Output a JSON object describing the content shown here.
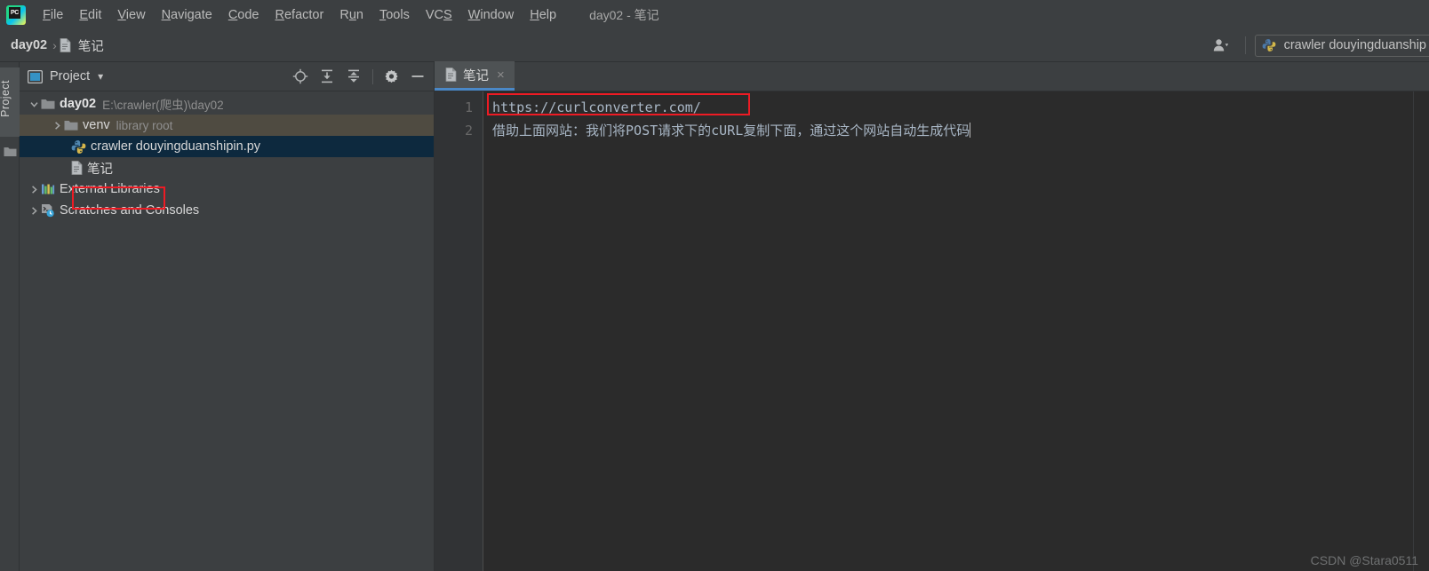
{
  "window": {
    "title": "day02 - 笔记",
    "app_icon": "pycharm-logo-icon",
    "logo_text": "PC"
  },
  "menubar": {
    "items": [
      {
        "label": "File",
        "mnemonic": "F"
      },
      {
        "label": "Edit",
        "mnemonic": "E"
      },
      {
        "label": "View",
        "mnemonic": "V"
      },
      {
        "label": "Navigate",
        "mnemonic": "N"
      },
      {
        "label": "Code",
        "mnemonic": "C"
      },
      {
        "label": "Refactor",
        "mnemonic": "R"
      },
      {
        "label": "Run",
        "mnemonic": "u"
      },
      {
        "label": "Tools",
        "mnemonic": "T"
      },
      {
        "label": "VCS",
        "mnemonic": "S"
      },
      {
        "label": "Window",
        "mnemonic": "W"
      },
      {
        "label": "Help",
        "mnemonic": "H"
      }
    ]
  },
  "navbar": {
    "breadcrumb": [
      {
        "label": "day02",
        "bold": true,
        "icon": ""
      },
      {
        "label": "笔记",
        "bold": false,
        "icon": "file-text-icon"
      }
    ],
    "separator": "›",
    "account_icon": "user-account-icon",
    "account_caret": "▾",
    "run_config": {
      "icon": "python-file-icon",
      "label": "crawler douyingduanship"
    }
  },
  "toolstrip": {
    "project_tab": "Project",
    "folder_icon": "folder-icon"
  },
  "project_panel": {
    "header": {
      "view_icon": "project-view-icon",
      "title": "Project",
      "dropdown_caret": "▾",
      "actions": [
        {
          "name": "locate-target-icon",
          "tooltip": "Select Opened File"
        },
        {
          "name": "expand-all-icon",
          "tooltip": "Expand All"
        },
        {
          "name": "collapse-all-icon",
          "tooltip": "Collapse All"
        },
        {
          "name": "gear-icon",
          "tooltip": "Settings"
        },
        {
          "name": "minimize-icon",
          "tooltip": "Hide"
        }
      ]
    },
    "tree": [
      {
        "label": "day02",
        "hint": "E:\\crawler(爬虫)\\day02",
        "icon": "folder-icon",
        "arrow": "expanded",
        "indent": 1,
        "bold": true,
        "state": "normal"
      },
      {
        "label": "venv",
        "hint": "library root",
        "icon": "folder-icon",
        "arrow": "collapsed",
        "indent": 2,
        "bold": false,
        "state": "venv"
      },
      {
        "label": "crawler douyingduanshipin.py",
        "hint": "",
        "icon": "python-file-icon",
        "arrow": "none",
        "indent": 3,
        "bold": false,
        "state": "selected"
      },
      {
        "label": "笔记",
        "hint": "",
        "icon": "file-text-icon",
        "arrow": "none",
        "indent": 3,
        "bold": false,
        "state": "normal"
      },
      {
        "label": "External Libraries",
        "hint": "",
        "icon": "external-libraries-icon",
        "arrow": "collapsed",
        "indent": 1,
        "bold": false,
        "state": "normal"
      },
      {
        "label": "Scratches and Consoles",
        "hint": "",
        "icon": "scratches-icon",
        "arrow": "collapsed",
        "indent": 1,
        "bold": false,
        "state": "normal"
      }
    ]
  },
  "editor": {
    "tab": {
      "icon": "file-text-icon",
      "label": "笔记",
      "close": "×"
    },
    "line_numbers": [
      "1",
      "2"
    ],
    "lines": [
      "https://curlconverter.com/",
      "借助上面网站：我们将POST请求下的cURL复制下面，通过这个网站自动生成代码"
    ]
  },
  "annotations": {
    "highlight_color": "#ee1b24",
    "boxes": [
      {
        "name": "url-highlight-box",
        "target": "editor line 1"
      },
      {
        "name": "notes-highlight-box",
        "target": "project tree 笔记"
      }
    ]
  },
  "watermark": {
    "text": "CSDN @Stara0511"
  },
  "colors": {
    "chrome_bg": "#3c3f41",
    "editor_bg": "#2b2b2b",
    "gutter_bg": "#313335",
    "tab_active_bg": "#4e5254",
    "tab_underline": "#4a88c7",
    "selection_bg": "#0d293e",
    "venv_row_bg": "#4f4b41",
    "code_fg": "#a9b7c6",
    "accent_red": "#ee1b24"
  }
}
